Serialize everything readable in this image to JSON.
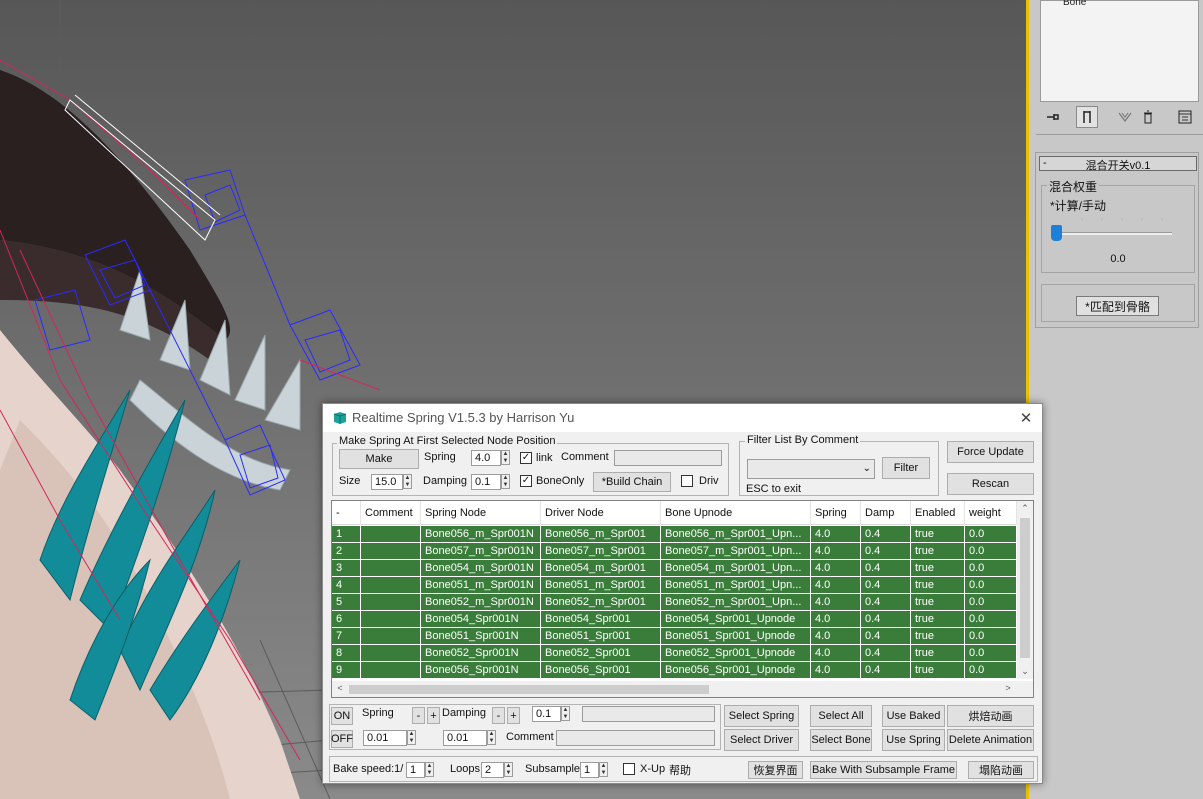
{
  "command_panel": {
    "modifier_item": "Bone",
    "rollout_title": "混合开关v0.1",
    "rollout_minus": "-",
    "group_label": "混合权重",
    "mode_label": "*计算/手动",
    "slider_value": "0.0",
    "slider_fraction": 0.0,
    "match_button": "*匹配到骨骼",
    "tools": [
      "pin-stack-icon",
      "show-end-result-icon",
      "make-unique-icon",
      "remove-modifier-icon",
      "configure-modifier-sets-icon"
    ]
  },
  "dialog": {
    "title": "Realtime Spring V1.5.3 by Harrison Yu",
    "close": "✕",
    "make_group": {
      "label": "Make Spring At First Selected Node Position",
      "make_button": "Make",
      "spring_label": "Spring",
      "spring_value": "4.0",
      "link_label": "link",
      "link_checked": true,
      "comment_label": "Comment",
      "comment_value": "",
      "size_label": "Size",
      "size_value": "15.0",
      "damping_label": "Damping",
      "damping_value": "0.1",
      "boneonly_label": "BoneOnly",
      "boneonly_checked": true,
      "build_chain_button": "*Build Chain",
      "driv_label": "Driv",
      "driv_checked": false
    },
    "filter_group": {
      "label": "Filter List By Comment",
      "dropdown_value": "",
      "filter_button": "Filter",
      "esc_hint": "ESC to exit"
    },
    "force_update_button": "Force Update",
    "rescan_button": "Rescan",
    "table": {
      "columns": [
        "-",
        "Comment",
        "Spring Node",
        "Driver Node",
        "Bone Upnode",
        "Spring",
        "Damp",
        "Enabled",
        "weight"
      ],
      "rows": [
        [
          "1",
          "",
          "Bone056_m_Spr001N",
          "Bone056_m_Spr001",
          "Bone056_m_Spr001_Upn...",
          "4.0",
          "0.4",
          "true",
          "0.0"
        ],
        [
          "2",
          "",
          "Bone057_m_Spr001N",
          "Bone057_m_Spr001",
          "Bone057_m_Spr001_Upn...",
          "4.0",
          "0.4",
          "true",
          "0.0"
        ],
        [
          "3",
          "",
          "Bone054_m_Spr001N",
          "Bone054_m_Spr001",
          "Bone054_m_Spr001_Upn...",
          "4.0",
          "0.4",
          "true",
          "0.0"
        ],
        [
          "4",
          "",
          "Bone051_m_Spr001N",
          "Bone051_m_Spr001",
          "Bone051_m_Spr001_Upn...",
          "4.0",
          "0.4",
          "true",
          "0.0"
        ],
        [
          "5",
          "",
          "Bone052_m_Spr001N",
          "Bone052_m_Spr001",
          "Bone052_m_Spr001_Upn...",
          "4.0",
          "0.4",
          "true",
          "0.0"
        ],
        [
          "6",
          "",
          "Bone054_Spr001N",
          "Bone054_Spr001",
          "Bone054_Spr001_Upnode",
          "4.0",
          "0.4",
          "true",
          "0.0"
        ],
        [
          "7",
          "",
          "Bone051_Spr001N",
          "Bone051_Spr001",
          "Bone051_Spr001_Upnode",
          "4.0",
          "0.4",
          "true",
          "0.0"
        ],
        [
          "8",
          "",
          "Bone052_Spr001N",
          "Bone052_Spr001",
          "Bone052_Spr001_Upnode",
          "4.0",
          "0.4",
          "true",
          "0.0"
        ],
        [
          "9",
          "",
          "Bone056_Spr001N",
          "Bone056_Spr001",
          "Bone056_Spr001_Upnode",
          "4.0",
          "0.4",
          "true",
          "0.0"
        ]
      ],
      "row_color": "#3a7d3a"
    },
    "controls": {
      "on_button": "ON",
      "off_button": "OFF",
      "spring_label": "Spring",
      "minus": "-",
      "plus": "+",
      "spring_value": "0.01",
      "damping_label": "Damping",
      "damping_value": "0.01",
      "weight_value": "0.1",
      "weight_field_value": "",
      "comment_label": "Comment",
      "comment_value": "",
      "select_spring_button": "Select Spring",
      "select_all_button": "Select All",
      "use_baked_button": "Use Baked",
      "bake_anim_button": "烘焙动画",
      "select_driver_button": "Select Driver",
      "select_bone_button": "Select Bone",
      "use_spring_button": "Use Spring",
      "delete_animation_button": "Delete Animation"
    },
    "bottom": {
      "bake_speed_label": "Bake speed:1/",
      "bake_speed_value": "1",
      "loops_label": "Loops",
      "loops_value": "2",
      "subsample_label": "Subsample",
      "subsample_value": "1",
      "xup_label": "X-Up",
      "xup_checked": false,
      "help_label": "帮助",
      "restore_ui_button": "恢复界面",
      "bake_subsample_button": "Bake With Subsample Frame",
      "collapse_anim_button": "塌陷动画"
    }
  },
  "colors": {
    "row_green": "#3a7d3a",
    "viewport_border": "#e8c200",
    "slider_blue": "#1d7fd8"
  }
}
